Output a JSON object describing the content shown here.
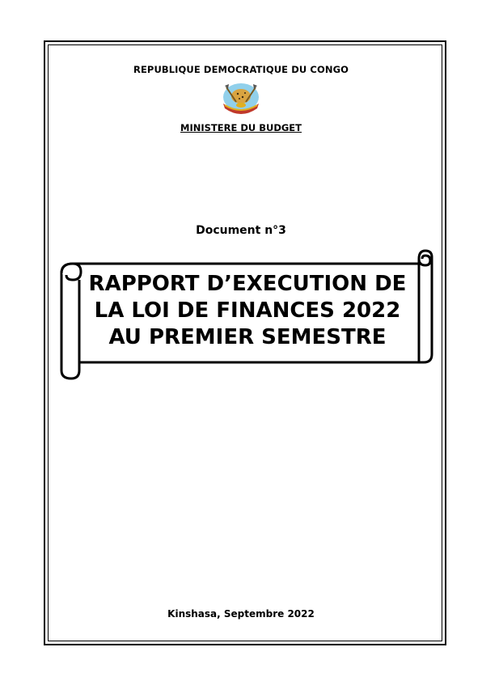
{
  "header": {
    "country": "REPUBLIQUE DEMOCRATIQUE DU CONGO",
    "ministry": "MINISTERE DU BUDGET"
  },
  "emblem": {
    "icon": "coat-of-arms-icon",
    "colors": {
      "sky": "#7ec8e8",
      "gold": "#e0b020",
      "red": "#c0392b",
      "leopard": "#d9a441"
    }
  },
  "document": {
    "number": "Document n°3",
    "title_lines": [
      "RAPPORT D’EXECUTION DE",
      "LA LOI DE FINANCES 2022",
      "AU PREMIER SEMESTRE"
    ]
  },
  "footer": {
    "place_date": "Kinshasa, Septembre 2022"
  }
}
